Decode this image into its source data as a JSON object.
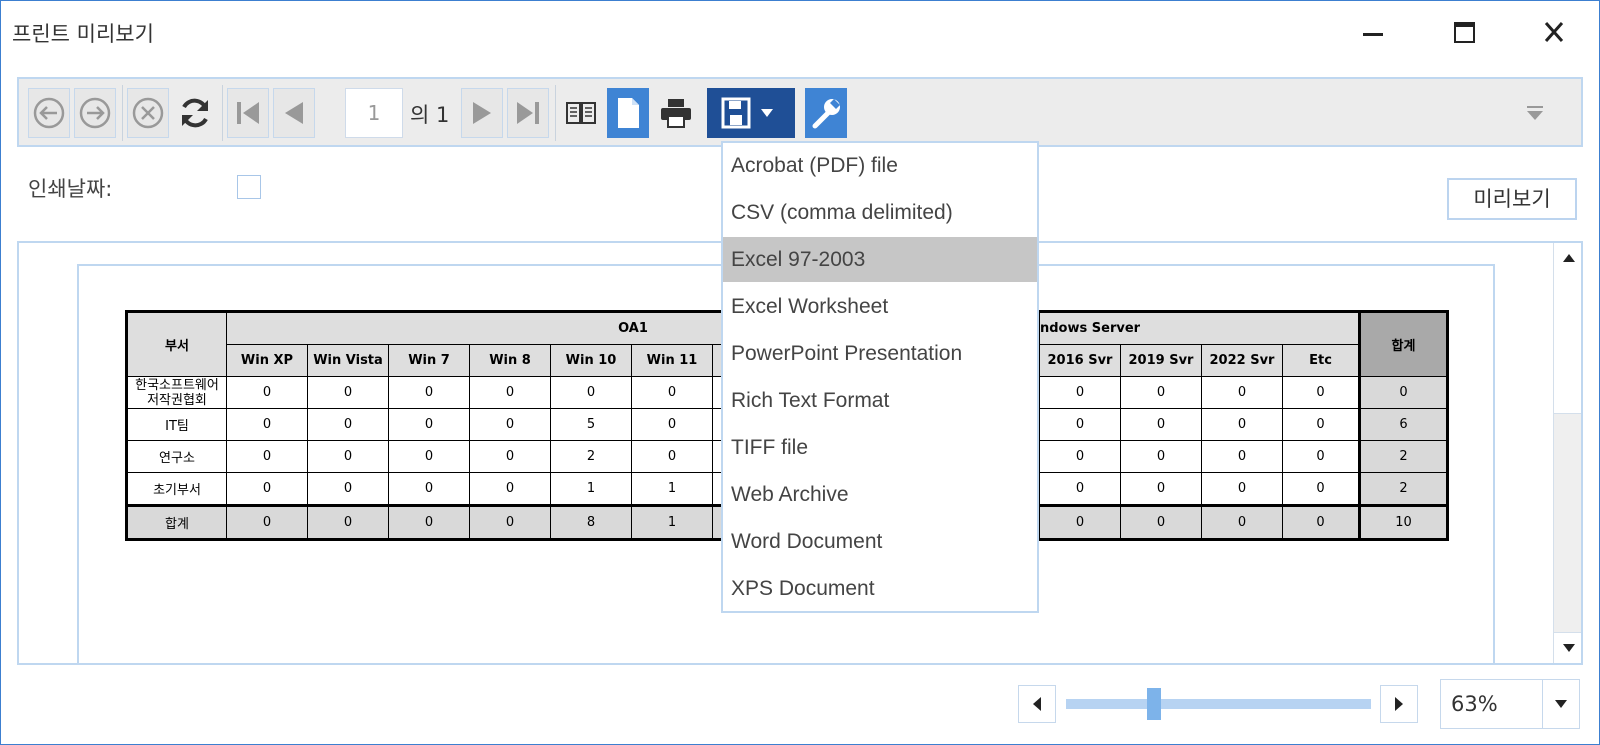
{
  "window": {
    "title": "프린트 미리보기"
  },
  "toolbar": {
    "page_number": "1",
    "page_of": "의 1"
  },
  "options": {
    "print_date_label": "인쇄날짜:",
    "preview_button": "미리보기"
  },
  "report": {
    "dept_header": "부서",
    "group_header": "OA1",
    "group_header_right": "ndows Server",
    "total_header": "합계",
    "left_columns": [
      "Win XP",
      "Win Vista",
      "Win 7",
      "Win 8",
      "Win 10",
      "Win 11"
    ],
    "right_columns": [
      "2016 Svr",
      "2019 Svr",
      "2022 Svr",
      "Etc"
    ],
    "rows": [
      {
        "dept_line1": "한국소프트웨어",
        "dept_line2": "저작권협회",
        "left": [
          "0",
          "0",
          "0",
          "0",
          "0",
          "0"
        ],
        "right": [
          "0",
          "0",
          "0",
          "0"
        ],
        "total": "0"
      },
      {
        "dept_line1": "IT팀",
        "dept_line2": "",
        "left": [
          "0",
          "0",
          "0",
          "0",
          "5",
          "0"
        ],
        "right": [
          "0",
          "0",
          "0",
          "0"
        ],
        "total": "6"
      },
      {
        "dept_line1": "연구소",
        "dept_line2": "",
        "left": [
          "0",
          "0",
          "0",
          "0",
          "2",
          "0"
        ],
        "right": [
          "0",
          "0",
          "0",
          "0"
        ],
        "total": "2"
      },
      {
        "dept_line1": "초기부서",
        "dept_line2": "",
        "left": [
          "0",
          "0",
          "0",
          "0",
          "1",
          "1"
        ],
        "right": [
          "0",
          "0",
          "0",
          "0"
        ],
        "total": "2"
      }
    ],
    "sum_row": {
      "label": "합계",
      "left": [
        "0",
        "0",
        "0",
        "0",
        "8",
        "1"
      ],
      "right": [
        "0",
        "0",
        "0",
        "0"
      ],
      "total": "10"
    }
  },
  "export_menu": {
    "items": [
      "Acrobat (PDF) file",
      "CSV (comma delimited)",
      "Excel 97-2003",
      "Excel Worksheet",
      "PowerPoint Presentation",
      "Rich Text Format",
      "TIFF file",
      "Web Archive",
      "Word Document",
      "XPS Document"
    ],
    "selected": "Excel 97-2003"
  },
  "zoom": {
    "value": "63%",
    "slider_fraction": 0.29
  },
  "colors": {
    "accent": "#3f84d4",
    "save_button": "#1f4f96",
    "border": "#bfd7f0"
  }
}
